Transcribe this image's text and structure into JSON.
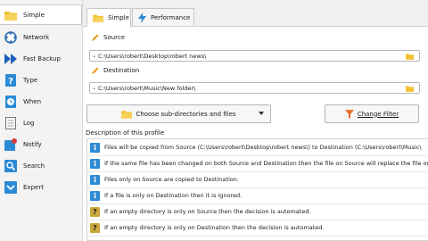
{
  "sidebar": {
    "items": [
      {
        "label": "Simple",
        "icon": "folder-icon",
        "active": true
      },
      {
        "label": "Network",
        "icon": "network-icon"
      },
      {
        "label": "Fast Backup",
        "icon": "fast-forward-icon"
      },
      {
        "label": "Type",
        "icon": "type-icon"
      },
      {
        "label": "When",
        "icon": "clock-icon"
      },
      {
        "label": "Log",
        "icon": "log-icon"
      },
      {
        "label": "Notify",
        "icon": "notify-icon"
      },
      {
        "label": "Search",
        "icon": "search-icon"
      },
      {
        "label": "Expert",
        "icon": "chevron-down-icon"
      }
    ]
  },
  "tabs": [
    {
      "label": "Simple",
      "icon": "folder-icon",
      "active": true
    },
    {
      "label": "Performance",
      "icon": "lightning-icon"
    }
  ],
  "source": {
    "label": "Source",
    "path": "C:\\Users\\robert\\Desktop\\robert news\\"
  },
  "destination": {
    "label": "Destination",
    "path": "C:\\Users\\robert\\Music\\New folder\\"
  },
  "buttons": {
    "subdirs": "Choose sub-directories and files",
    "change_filter": "Change Filter"
  },
  "description": {
    "title": "Description of this profile",
    "rows": [
      {
        "type": "info",
        "text": "Files will be copied from Source (C:\\Users\\robert\\Desktop\\robert news\\) to Destination (C:\\Users\\robert\\Music\\"
      },
      {
        "type": "info",
        "text": "If the same file has been changed on both Source and Destination then the file on Source will replace the file on"
      },
      {
        "type": "info",
        "text": "Files only on Source are copied to Destination."
      },
      {
        "type": "info",
        "text": "If a file is only on Destination then it is ignored."
      },
      {
        "type": "question",
        "text": "If an empty directory is only on Source then the decision is automated."
      },
      {
        "type": "question",
        "text": "If an empty directory is only on Destination then the decision is automated."
      }
    ]
  },
  "colors": {
    "accent_blue": "#2b8bd6",
    "folder_yellow": "#f2c233",
    "pencil_orange": "#e89a1c",
    "filter_orange": "#e8702a"
  }
}
